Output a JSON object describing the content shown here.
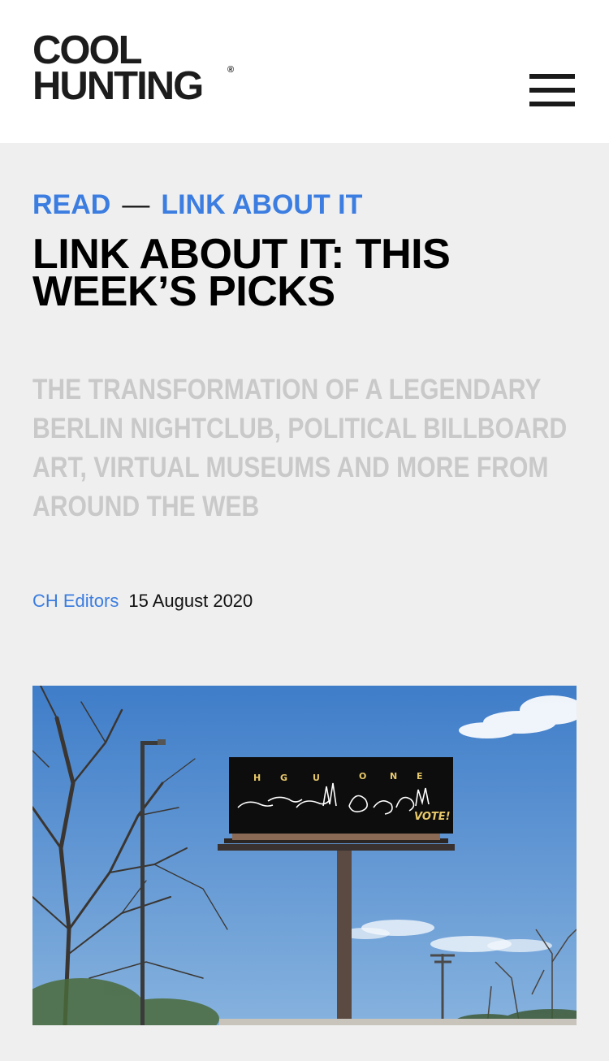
{
  "header": {
    "logo": {
      "line1": "COOL",
      "line2": "HUNTING",
      "reg": "®"
    },
    "menu_icon": "hamburger-menu-icon"
  },
  "article": {
    "breadcrumb": {
      "section": "READ",
      "separator": "—",
      "category": "LINK ABOUT IT"
    },
    "title": "LINK ABOUT IT: THIS WEEK’S PICKS",
    "subtitle": "THE TRANSFORMATION OF A LEGENDARY BERLIN NIGHTCLUB, POLITICAL BILLBOARD ART, VIRTUAL MUSEUMS AND MORE FROM AROUND THE WEB",
    "author": "CH Editors",
    "date": "15 August 2020"
  },
  "hero_image": {
    "billboard_letters": [
      "H",
      "G",
      "U",
      "O",
      "N",
      "E"
    ],
    "billboard_vote": "VOTE!"
  },
  "colors": {
    "accent": "#3b7de0",
    "background": "#efefef",
    "header_bg": "#ffffff",
    "subtitle": "#c9c9c9",
    "text": "#000000"
  }
}
